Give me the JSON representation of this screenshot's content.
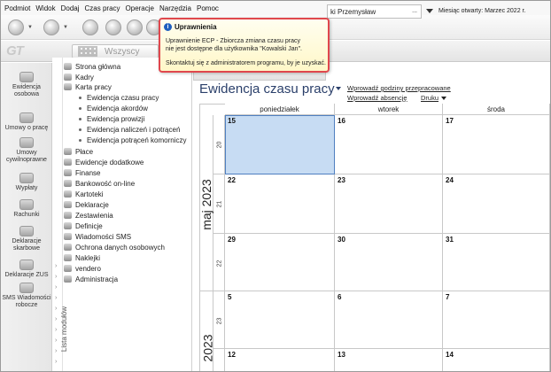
{
  "menubar": [
    "Podmiot",
    "Widok",
    "Dodaj",
    "Czas pracy",
    "Operacje",
    "Narzędzia",
    "Pomoc"
  ],
  "header": {
    "logo": "GT",
    "all_button": "Wszyscy",
    "company_value": "ki Przemysław",
    "company_ellipsis": "...",
    "open_month": "Miesiąc otwarty: Marzec 2022 r."
  },
  "sidebar": {
    "items": [
      "Ewidencja osobowa",
      "Umowy o pracę",
      "Umowy cywilnoprawne",
      "Wypłaty",
      "Rachunki",
      "Deklaracje skarbowe",
      "Deklaracje ZUS",
      "SMS Wiadomości robocze"
    ],
    "icon_badge": "SMS"
  },
  "tree": {
    "vertical_label": "Lista modułów",
    "items": [
      {
        "label": "Strona główna",
        "sub": false
      },
      {
        "label": "Kadry",
        "sub": false
      },
      {
        "label": "Karta pracy",
        "sub": false
      },
      {
        "label": "Ewidencja czasu pracy",
        "sub": true
      },
      {
        "label": "Ewidencja akordów",
        "sub": true
      },
      {
        "label": "Ewidencja prowizji",
        "sub": true
      },
      {
        "label": "Ewidencja naliczeń i potrąceń",
        "sub": true
      },
      {
        "label": "Ewidencja potrąceń komorniczy",
        "sub": true
      },
      {
        "label": "Płace",
        "sub": false
      },
      {
        "label": "Ewidencje dodatkowe",
        "sub": false
      },
      {
        "label": "Finanse",
        "sub": false
      },
      {
        "label": "Bankowość on-line",
        "sub": false
      },
      {
        "label": "Kartoteki",
        "sub": false
      },
      {
        "label": "Deklaracje",
        "sub": false
      },
      {
        "label": "Zestawienia",
        "sub": false
      },
      {
        "label": "Definicje",
        "sub": false
      },
      {
        "label": "Wiadomości SMS",
        "sub": false
      },
      {
        "label": "Ochrona danych osobowych",
        "sub": false
      },
      {
        "label": "Naklejki",
        "sub": false
      },
      {
        "label": "vendero",
        "sub": false
      },
      {
        "label": "Administracja",
        "sub": false
      }
    ]
  },
  "content": {
    "title": "Ewidencja czasu pracy",
    "links": {
      "overtime": "Wprowadź godziny przepracowane",
      "absence": "Wprowadź absencję",
      "print": "Druku"
    }
  },
  "calendar": {
    "days": [
      "poniedziałek",
      "wtorek",
      "środa"
    ],
    "months": [
      {
        "label": "maj 2023"
      },
      {
        "label": "2023"
      }
    ],
    "weeks": [
      {
        "week": "20",
        "dates": [
          "15",
          "16",
          "17"
        ]
      },
      {
        "week": "21",
        "dates": [
          "22",
          "23",
          "24"
        ]
      },
      {
        "week": "22",
        "dates": [
          "29",
          "30",
          "31"
        ]
      },
      {
        "week": "23",
        "dates": [
          "5",
          "6",
          "7"
        ]
      },
      {
        "week": "24",
        "dates": [
          "12",
          "13",
          "14"
        ]
      }
    ],
    "selected": "15"
  },
  "tooltip": {
    "title": "Uprawnienia",
    "line1": "Uprawnienie ECP - Zbiorcza zmiana czasu pracy",
    "line2": "nie jest dostępne dla użytkownika \"Kowalski Jan\".",
    "line3": "Skontaktuj się z administratorem programu, by je uzyskać."
  },
  "colors": {
    "accent_title": "#2a3f6a",
    "tooltip_border": "#e0474d",
    "selected_cell": "#c7dcf3"
  }
}
